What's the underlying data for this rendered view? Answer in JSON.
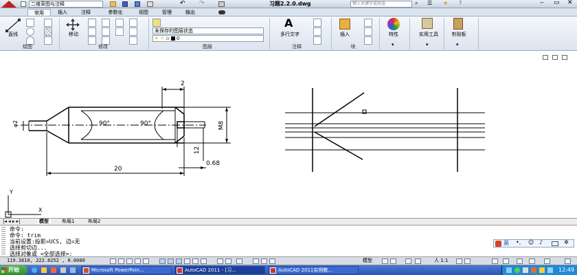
{
  "window": {
    "title": "习题2.2.0.dwg",
    "workspace": "二维草图与注释",
    "search_placeholder": "键入关键字或短语"
  },
  "menu_tabs": [
    "常用",
    "插入",
    "注释",
    "参数化",
    "视图",
    "管理",
    "输出"
  ],
  "ribbon": {
    "line_label": "直线",
    "move_label": "移动",
    "layer_state": "未保存的图层状态",
    "layer_current": "0",
    "mtext_label": "多行文字",
    "insert_label": "插入",
    "properties_label": "特性",
    "utilities_label": "实用工具",
    "clipboard_label": "剪贴板",
    "groups": [
      "绘图",
      "修改",
      "图层",
      "注释",
      "块"
    ]
  },
  "dimensions": {
    "d2": "2",
    "phi2": "φ2",
    "angle1": "90°",
    "angle2": "90°",
    "m8": "M8",
    "d12": "12",
    "d068": "0.68",
    "d20": "20"
  },
  "ucs": {
    "x": "X",
    "y": "Y"
  },
  "layout_tabs": [
    "模型",
    "布局1",
    "布局2"
  ],
  "command_lines": [
    "命令:",
    "命令:  trim",
    "当前设置:投影=UCS, 边=无",
    "选择剪切边...",
    "选择对象或 <全部选择>:"
  ],
  "status": {
    "coords": "119.3610, 222.8252 , 0.0000",
    "model_label": "模型",
    "scale": "人 1:1",
    "ime": "英"
  },
  "taskbar": {
    "start": "开始",
    "items": [
      "Microsoft PowerPoin...",
      "AutoCAD 2011 - [习...",
      "AutoCAD 2011实例教..."
    ],
    "clock": "12:49"
  }
}
